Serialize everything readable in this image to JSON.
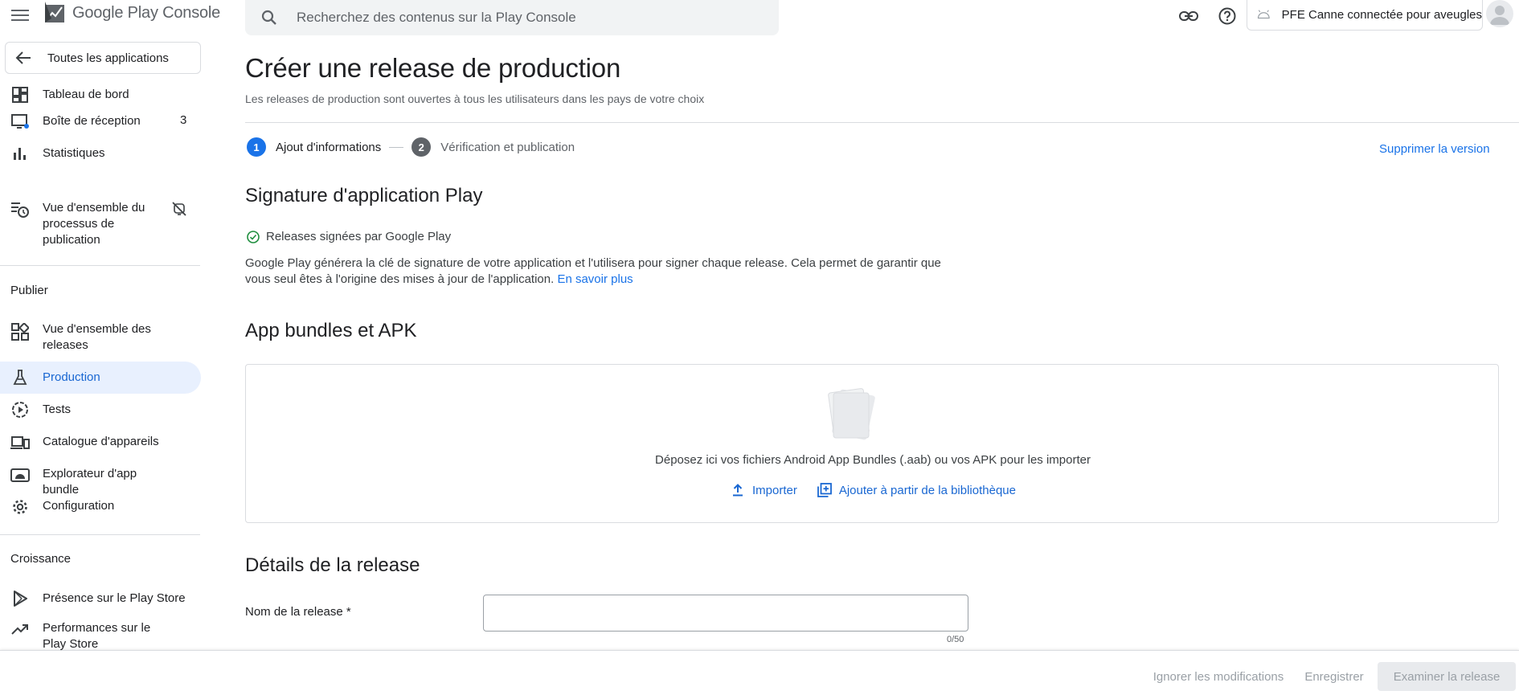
{
  "header": {
    "app_name": "Google Play Console",
    "search_placeholder": "Recherchez des contenus sur la Play Console",
    "account_name": "PFE Canne connectée pour aveugles"
  },
  "sidebar": {
    "back_label": "Toutes les applications",
    "items_top": [
      {
        "label": "Tableau de bord"
      },
      {
        "label": "Boîte de réception",
        "badge": "3"
      },
      {
        "label": "Statistiques"
      },
      {
        "label": "Vue d'ensemble du processus de publication"
      }
    ],
    "section_publish": "Publier",
    "items_publish": [
      {
        "label": "Vue d'ensemble des releases"
      },
      {
        "label": "Production"
      },
      {
        "label": "Tests"
      },
      {
        "label": "Catalogue d'appareils"
      },
      {
        "label": "Explorateur d'app bundle"
      },
      {
        "label": "Configuration"
      }
    ],
    "section_growth": "Croissance",
    "items_growth": [
      {
        "label": "Présence sur le Play Store"
      },
      {
        "label": "Performances sur le Play Store"
      }
    ]
  },
  "main": {
    "title": "Créer une release de production",
    "subtitle": "Les releases de production sont ouvertes à tous les utilisateurs dans les pays de votre choix",
    "steps": [
      {
        "num": "1",
        "label": "Ajout d'informations"
      },
      {
        "num": "2",
        "label": "Vérification et publication"
      }
    ],
    "delete_link": "Supprimer la version",
    "signing": {
      "heading": "Signature d'application Play",
      "status": "Releases signées par Google Play",
      "description": "Google Play générera la clé de signature de votre application et l'utilisera pour signer chaque release. Cela permet de garantir que vous seul êtes à l'origine des mises à jour de l'application.",
      "learn_more": "En savoir plus"
    },
    "bundles": {
      "heading": "App bundles et APK",
      "drop_text": "Déposez ici vos fichiers Android App Bundles (.aab) ou vos APK pour les importer",
      "import_label": "Importer",
      "library_label": "Ajouter à partir de la bibliothèque"
    },
    "details": {
      "heading": "Détails de la release",
      "name_label": "Nom de la release  *",
      "name_value": "",
      "name_counter": "0/50"
    }
  },
  "footer": {
    "discard_label": "Ignorer les modifications",
    "save_label": "Enregistrer",
    "review_label": "Examiner la release"
  },
  "colors": {
    "accent": "#1a73e8",
    "active_nav_bg": "#e8f0fe",
    "success_green": "#1e8e3e"
  }
}
